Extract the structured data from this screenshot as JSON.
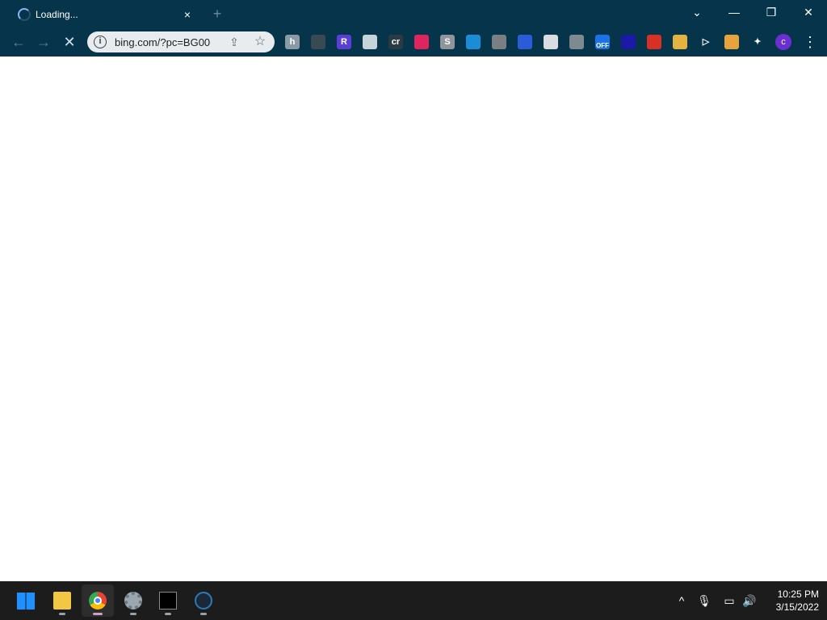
{
  "tab": {
    "title": "Loading...",
    "close_glyph": "×",
    "new_tab_glyph": "+"
  },
  "window_controls": {
    "dropdown": "⌄",
    "minimize": "—",
    "restore": "❐",
    "close": "✕"
  },
  "toolbar": {
    "back_glyph": "←",
    "forward_glyph": "→",
    "stop_glyph": "✕",
    "url": "bing.com/?pc=BG00",
    "share_glyph": "⇪",
    "star_glyph": "☆",
    "menu_glyph": "⋮",
    "profile_initial": "c"
  },
  "extensions": [
    {
      "name": "ext-1-icon",
      "label": "h",
      "color": "#8a9ba5"
    },
    {
      "name": "ext-2-icon",
      "label": "",
      "color": "#3a4a52"
    },
    {
      "name": "ext-3-icon",
      "label": "R",
      "color": "#5a3fd6"
    },
    {
      "name": "ext-4-icon",
      "label": "",
      "color": "#c5d3db"
    },
    {
      "name": "ext-5-icon",
      "label": "cr",
      "color": "#2b3b44"
    },
    {
      "name": "ext-6-icon",
      "label": "",
      "color": "#e0245e"
    },
    {
      "name": "ext-7-icon",
      "label": "S",
      "color": "#8f959a"
    },
    {
      "name": "ext-8-icon",
      "label": "",
      "color": "#1a8cd8"
    },
    {
      "name": "ext-9-icon",
      "label": "",
      "color": "#7a7f84"
    },
    {
      "name": "ext-10-icon",
      "label": "",
      "color": "#2b5bd6"
    },
    {
      "name": "ext-11-icon",
      "label": "",
      "color": "#d9dde1"
    },
    {
      "name": "ext-12-icon",
      "label": "",
      "color": "#7f8a90"
    },
    {
      "name": "ext-13-icon",
      "label": "OFF",
      "color": "#1a73e8"
    },
    {
      "name": "ext-14-icon",
      "label": "",
      "color": "#1a1aa6"
    },
    {
      "name": "ext-15-icon",
      "label": "",
      "color": "#d93025"
    },
    {
      "name": "ext-16-icon",
      "label": "",
      "color": "#e3b341"
    },
    {
      "name": "ext-17-icon",
      "label": "▷",
      "color": "#06344a"
    },
    {
      "name": "ext-18-icon",
      "label": "",
      "color": "#e8a33d"
    },
    {
      "name": "puzzle-icon",
      "label": "✦",
      "color": "#06344a"
    }
  ],
  "taskbar": {
    "apps": [
      {
        "name": "start-button",
        "color": "#1e90ff"
      },
      {
        "name": "file-explorer-icon",
        "color": "#f2c744"
      },
      {
        "name": "chrome-icon",
        "color": "#4285f4"
      },
      {
        "name": "settings-icon",
        "color": "#9aa7b0"
      },
      {
        "name": "terminal-icon",
        "color": "#000000"
      },
      {
        "name": "steam-icon",
        "color": "#1b2838"
      }
    ],
    "tray": {
      "chevron": "^",
      "mic": "🎙",
      "network": "▭",
      "volume": "🔊"
    },
    "time": "10:25 PM",
    "date": "3/15/2022"
  }
}
